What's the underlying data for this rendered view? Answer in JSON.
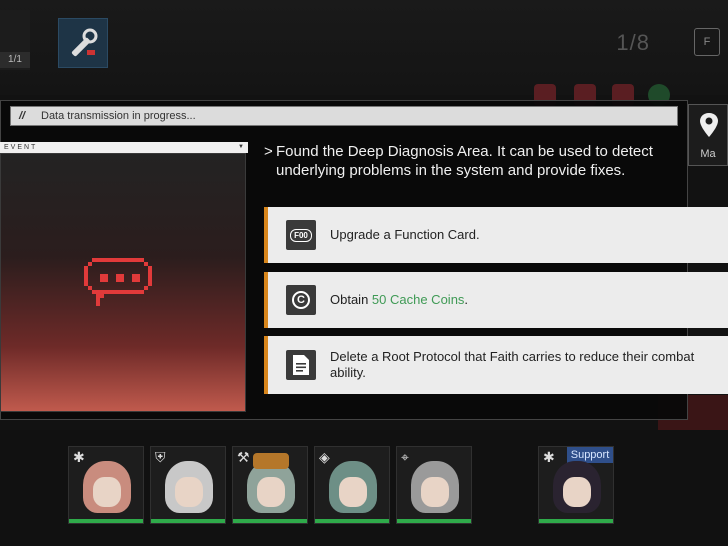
{
  "hud": {
    "counter": "1/1",
    "step": "1/8",
    "function_card_button": "F",
    "map_label": "Ma"
  },
  "dialog": {
    "header": "Data transmission in progress...",
    "event_tag": "EVENT",
    "description_prefix": ">",
    "description": "Found the Deep Diagnosis Area. It can be used to detect underlying problems in the system and provide fixes."
  },
  "options": [
    {
      "icon": "function-card-icon",
      "icon_text": "F00",
      "text": "Upgrade a Function Card."
    },
    {
      "icon": "cache-coin-icon",
      "icon_text": "C",
      "text_before": "Obtain ",
      "highlight": "50 Cache Coins",
      "text_after": "."
    },
    {
      "icon": "document-icon",
      "text": "Delete a Root Protocol that Faith carries to reduce their combat ability."
    }
  ],
  "team": {
    "support_label": "Support"
  },
  "colors": {
    "accent": "#d8861c",
    "highlight": "#3f9a55",
    "hp": "#2faa4a",
    "event_red": "#c05a4d"
  }
}
